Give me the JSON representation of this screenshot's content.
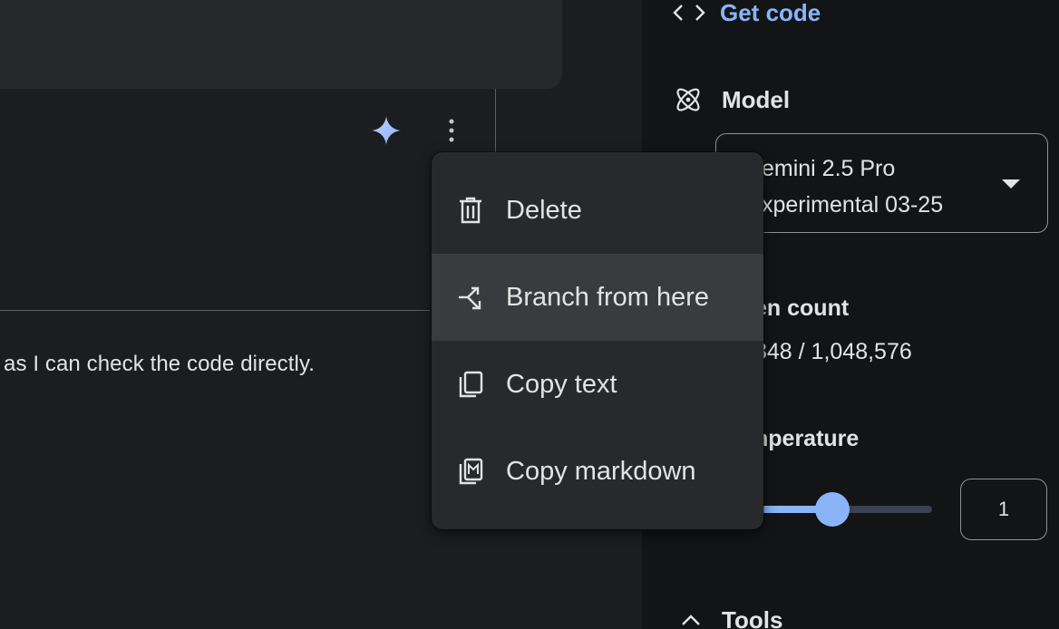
{
  "chat": {
    "response_text": "as I can check the code directly."
  },
  "context_menu": {
    "items": [
      {
        "label": "Delete",
        "icon": "trash-icon"
      },
      {
        "label": "Branch from here",
        "icon": "branch-icon"
      },
      {
        "label": "Copy text",
        "icon": "copy-icon"
      },
      {
        "label": "Copy markdown",
        "icon": "copy-markdown-icon"
      }
    ],
    "hovered_index": 1
  },
  "panel": {
    "get_code_label": "Get code",
    "model_label": "Model",
    "model_value_line1": "emini 2.5 Pro",
    "model_value_line2": "xperimental 03-25",
    "token_count_label": "en count",
    "token_count_value": "848 / 1,048,576",
    "temperature_label": "nperature",
    "temperature_value": "1",
    "temperature_slider_fraction": 0.5,
    "tools_label": "Tools"
  },
  "colors": {
    "accent": "#8ab4f8",
    "panel_bg": "#131416",
    "chat_bg": "#1c1d20",
    "menu_bg": "#28292d"
  }
}
